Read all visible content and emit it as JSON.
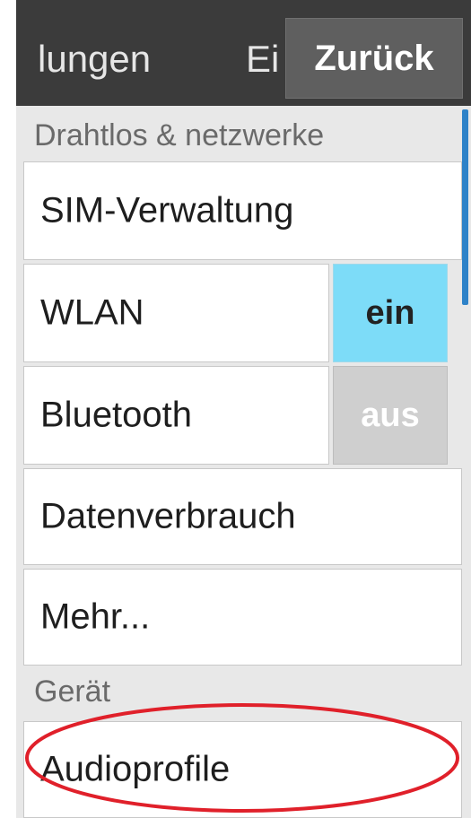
{
  "titlebar": {
    "title_part1": "lungen",
    "title_part2": "Ei",
    "back_label": "Zurück"
  },
  "sections": {
    "wireless_header": "Drahtlos & netzwerke",
    "device_header": "Gerät"
  },
  "rows": {
    "sim": "SIM-Verwaltung",
    "wlan": "WLAN",
    "wlan_toggle": "ein",
    "bluetooth": "Bluetooth",
    "bluetooth_toggle": "aus",
    "data_usage": "Datenverbrauch",
    "more": "Mehr...",
    "audio_profiles": "Audioprofile"
  },
  "colors": {
    "toggle_on": "#7ddcf8",
    "toggle_off": "#cfcfcf",
    "annotation": "#e0202a",
    "scrollbar": "#2e82c8"
  },
  "icons": {
    "annotation": "red-ellipse-highlight"
  }
}
